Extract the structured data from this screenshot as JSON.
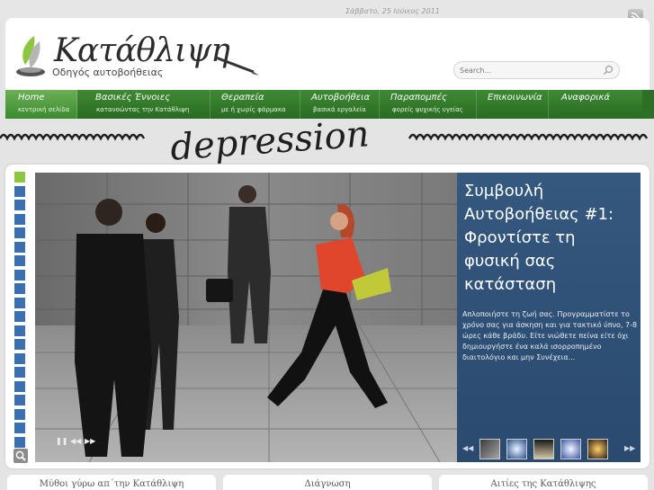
{
  "header": {
    "date": "Σάββατο, 25 Ιούνιος 2011",
    "logo_title": "Κατάθλιψη",
    "logo_subtitle": "Οδηγός αυτοβοήθειας",
    "search_placeholder": "Search..."
  },
  "nav": [
    {
      "label": "Home",
      "sub": "κεντρική σελίδα"
    },
    {
      "label": "Βασικές Έννοιες",
      "sub": "κατανοώντας την Κατάθλιψη"
    },
    {
      "label": "Θεραπεία",
      "sub": "με ή χωρίς φάρμακα"
    },
    {
      "label": "Αυτοβοήθεια",
      "sub": "βασικά εργαλεία"
    },
    {
      "label": "Παραπομπές",
      "sub": "φορείς ψυχικής υγείας"
    },
    {
      "label": "Επικοινωνία",
      "sub": ""
    },
    {
      "label": "Αναφορικά",
      "sub": ""
    }
  ],
  "banner_text": "depression",
  "slider": {
    "title": "Συμβουλή Αυτοβοήθειας #1: Φροντίστε τη φυσική σας κατάσταση",
    "text": "Απλοποιήστε τη ζωή σας. Προγραμματίστε το χρόνο σας για άσκηση και για τακτικό ύπνο, 7-8 ώρες κάθε βράδυ. Είτε νιώθετε πείνα είτε όχι δημιουργήστε ένα καλά ισορροπημένο διαιτολόγιο και μην Συνέχεια..."
  },
  "bottom_tabs": [
    "Μύθοι γύρω απ΄την Κατάθλιψη",
    "Διάγνωση",
    "Αιτίες της Κατάθλιψης"
  ],
  "colors": {
    "nav_green": "#2f7a27",
    "caption_blue": "#35587f",
    "thumb_blue": "#3c6fb0",
    "thumb_active": "#8dc63f"
  }
}
